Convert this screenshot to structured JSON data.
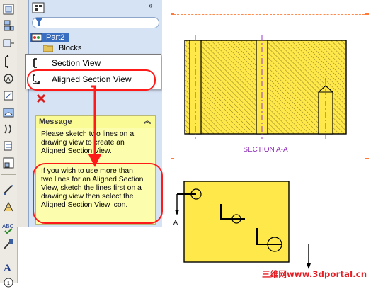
{
  "property_manager": {
    "tree_item": "Part2",
    "tree_child": "Blocks",
    "message_title": "Message",
    "message_para1": [
      "Please sketch two lines on a",
      "drawing view to create an",
      "Aligned Section View."
    ],
    "message_para2": [
      "If you wish to use more than",
      "two lines for an Aligned Section",
      "View, sketch the lines first on a",
      "drawing view then select the",
      "Aligned Section View icon."
    ]
  },
  "dropdown_menu": {
    "items": [
      {
        "label": "Section View",
        "icon": "section-view-icon"
      },
      {
        "label": "Aligned Section View",
        "icon": "aligned-section-view-icon"
      }
    ]
  },
  "drawing": {
    "section_label": "SECTION A-A",
    "cut_label": "A",
    "watermark": "三维网www.3dportal.cn"
  },
  "colors": {
    "part_fill": "#ffe84a",
    "hatch": "#8a7a20",
    "highlight_red": "#ff1a1a",
    "panel_bg": "#d6e3f5",
    "message_bg": "#fdfdae",
    "sketch_border": "#ff8a4a",
    "section_label_color": "#8b2bb3"
  }
}
